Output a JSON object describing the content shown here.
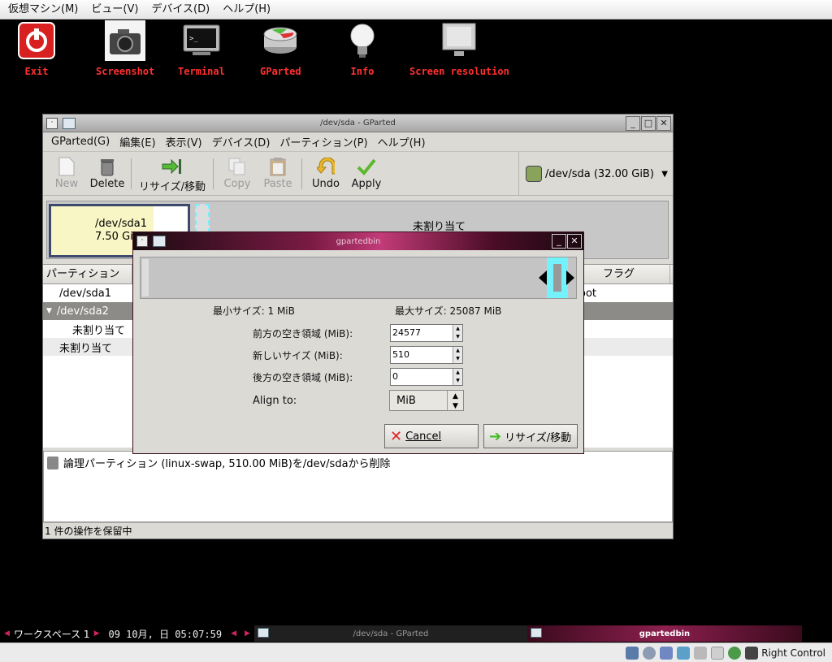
{
  "host_menu": [
    "仮想マシン(M)",
    "ビュー(V)",
    "デバイス(D)",
    "ヘルプ(H)"
  ],
  "desktop_icons": [
    {
      "label": "Exit",
      "icon": "power-icon"
    },
    {
      "label": "Screenshot",
      "icon": "camera-icon"
    },
    {
      "label": "Terminal",
      "icon": "terminal-icon"
    },
    {
      "label": "GParted",
      "icon": "gparted-icon"
    },
    {
      "label": "Info",
      "icon": "lightbulb-icon"
    },
    {
      "label": "Screen resolution",
      "icon": "monitor-icon"
    }
  ],
  "gparted": {
    "title": "/dev/sda - GParted",
    "menu": [
      "GParted(G)",
      "編集(E)",
      "表示(V)",
      "デバイス(D)",
      "パーティション(P)",
      "ヘルプ(H)"
    ],
    "toolbar": {
      "new": "New",
      "delete": "Delete",
      "resize": "リサイズ/移動",
      "copy": "Copy",
      "paste": "Paste",
      "undo": "Undo",
      "apply": "Apply"
    },
    "device": "/dev/sda  (32.00 GiB)",
    "diskmap": {
      "part1_name": "/dev/sda1",
      "part1_size": "7.50 GiB",
      "unallocated": "未割り当て"
    },
    "table": {
      "col_partition": "パーティション",
      "col_flags": "フラグ",
      "rows": [
        {
          "name": "/dev/sda1",
          "flags": "oot"
        },
        {
          "name": "/dev/sda2",
          "flags": ""
        },
        {
          "name": "未割り当て",
          "flags": ""
        },
        {
          "name": "未割り当て",
          "flags": ""
        }
      ]
    },
    "pending_op": "論理パーティション (linux-swap, 510.00 MiB)を/dev/sdaから削除",
    "status": "1 件の操作を保留中"
  },
  "dialog": {
    "title": "gpartedbin",
    "min_size": "最小サイズ: 1 MiB",
    "max_size": "最大サイズ: 25087 MiB",
    "free_before_label": "前方の空き領域 (MiB):",
    "free_before_value": "24577",
    "new_size_label": "新しいサイズ (MiB):",
    "new_size_value": "510",
    "free_after_label": "後方の空き領域 (MiB):",
    "free_after_value": "0",
    "align_label": "Align to:",
    "align_value": "MiB",
    "cancel": "Cancel",
    "resize": "リサイズ/移動"
  },
  "taskbar": {
    "workspace": "ワークスペース 1",
    "clock": "09 10月, 日 05:07:59",
    "task1": "/dev/sda - GParted",
    "task2": "gpartedbin"
  },
  "host_status": {
    "host_key": "Right Control"
  },
  "colors": {
    "accent": "#c23b78",
    "desktop_label": "#ff3030",
    "handle": "#74f2fb"
  }
}
